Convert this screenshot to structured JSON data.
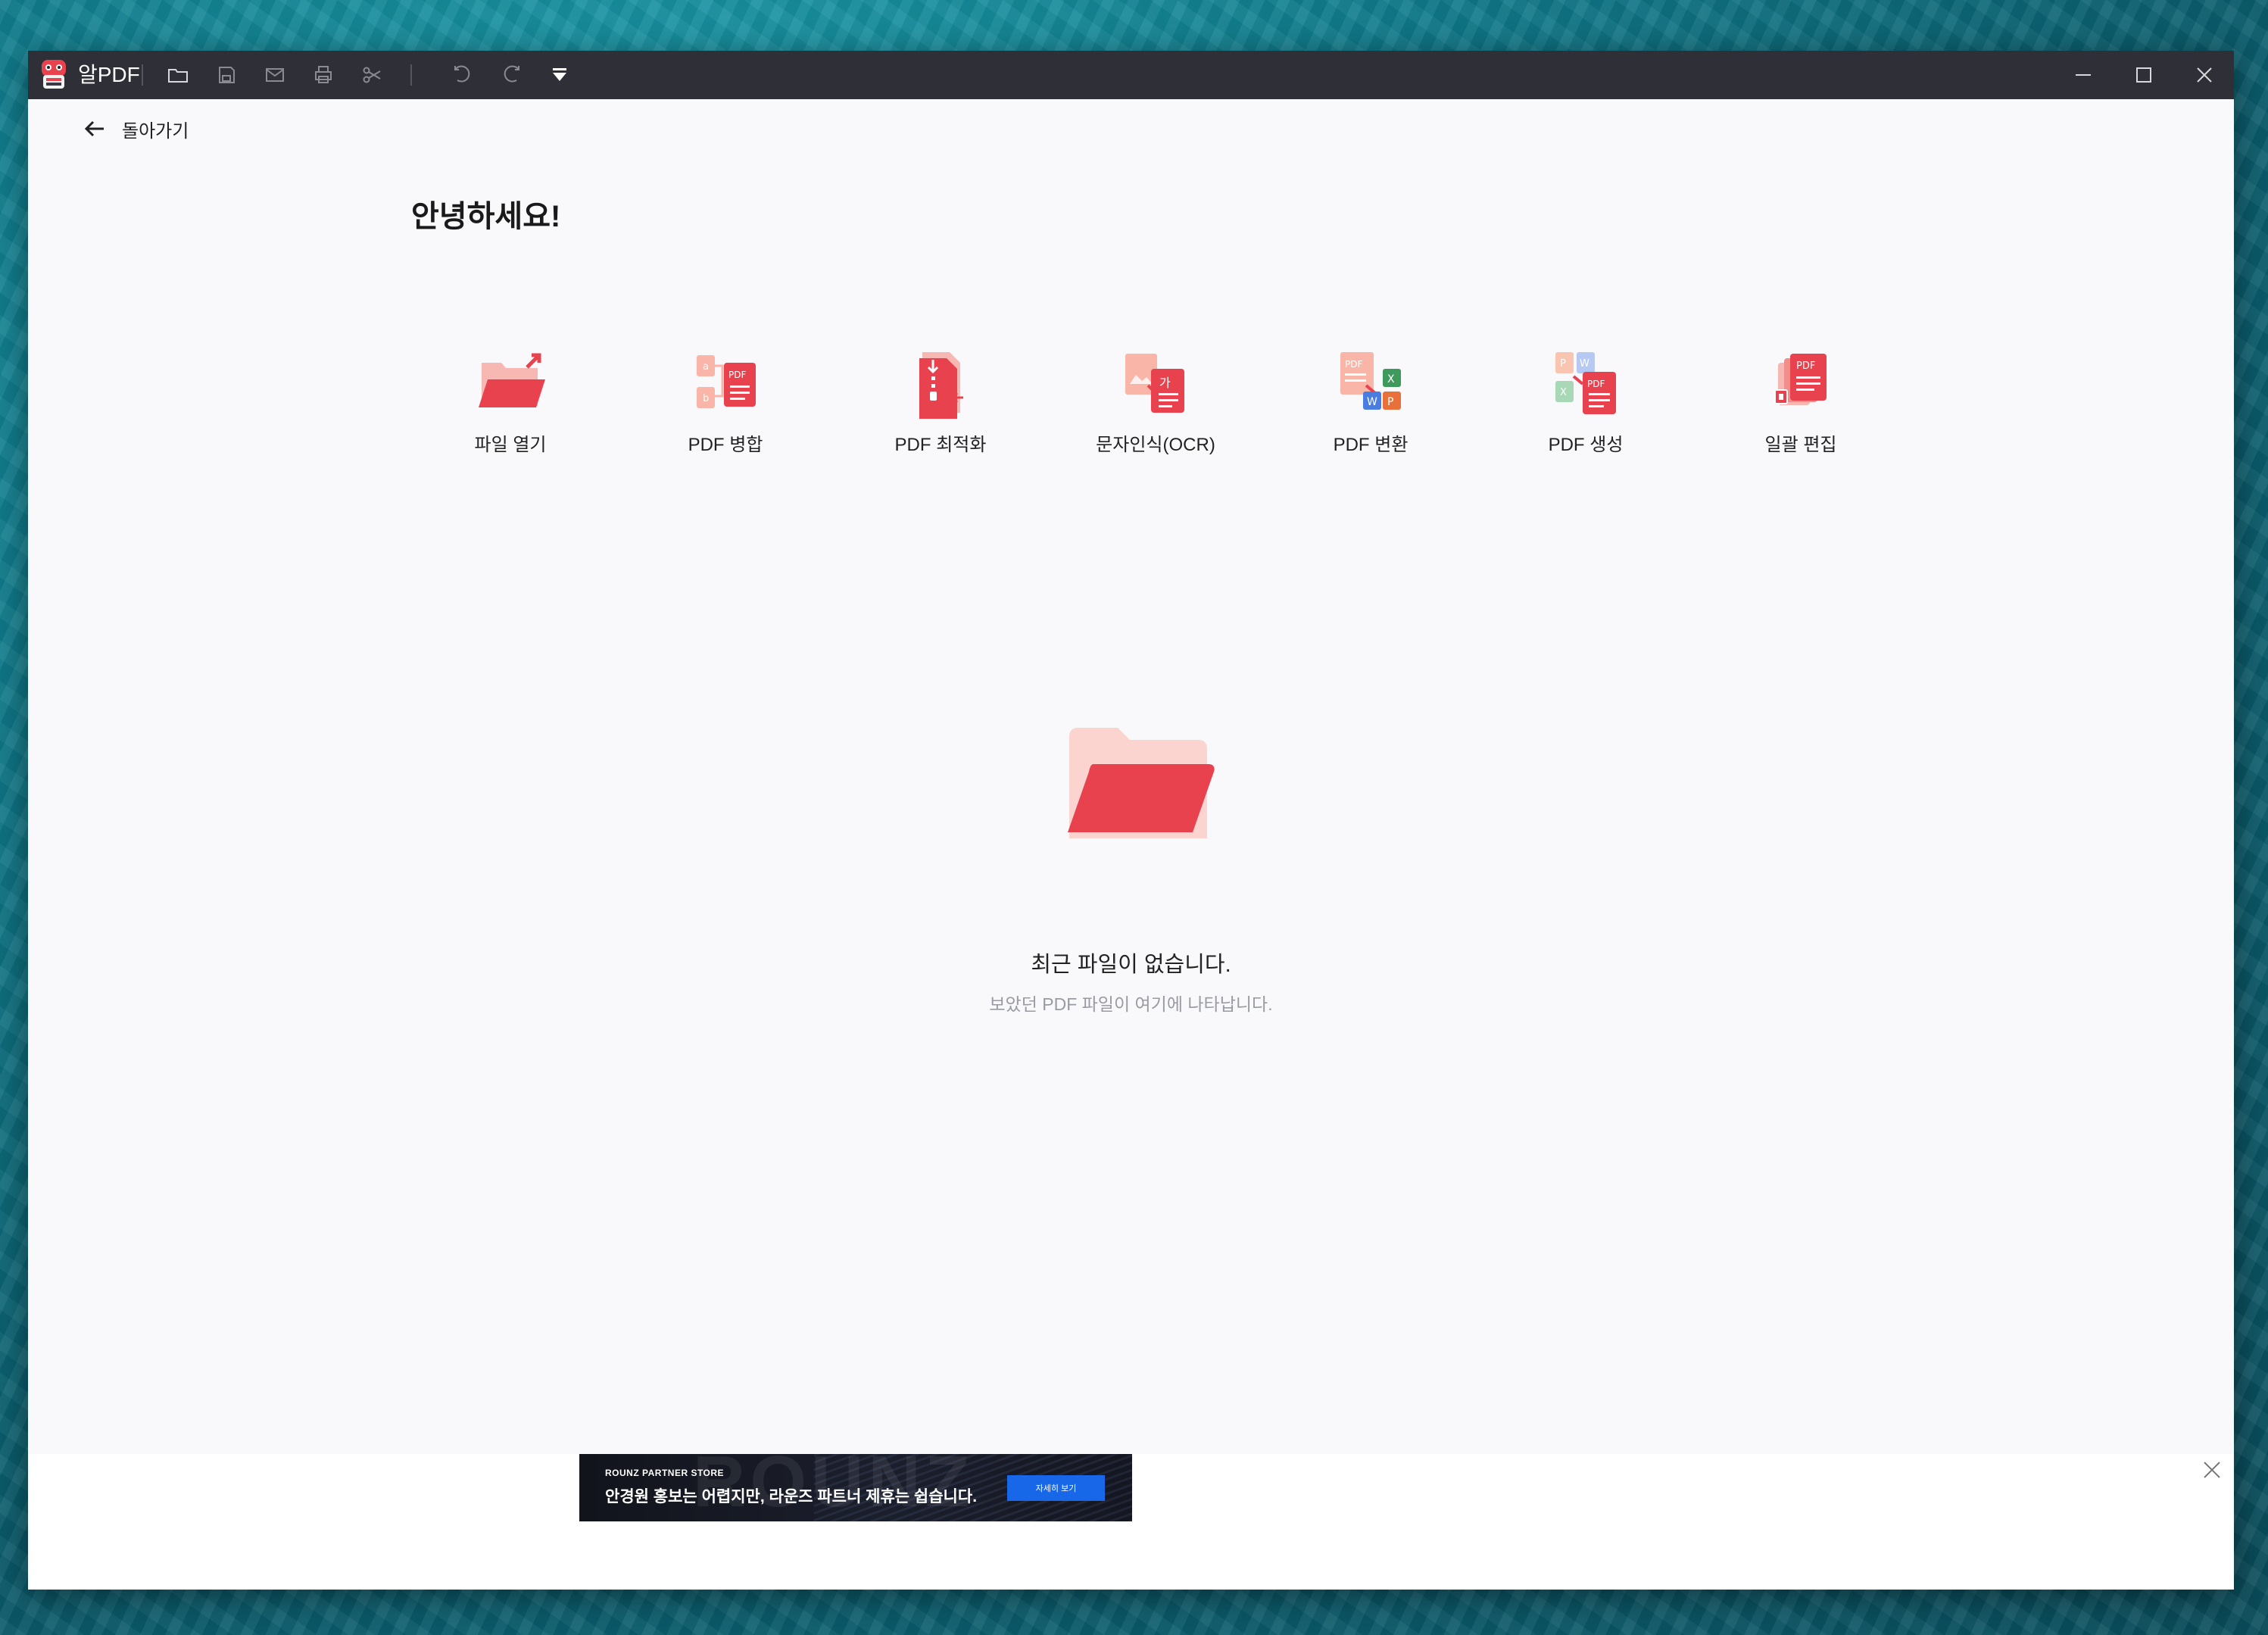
{
  "app": {
    "title": "알PDF"
  },
  "nav": {
    "back_label": "돌아가기"
  },
  "home": {
    "greeting": "안녕하세요!",
    "tools": [
      {
        "label": "파일 열기",
        "icon": "folder-open-icon"
      },
      {
        "label": "PDF 병합",
        "icon": "pdf-merge-icon"
      },
      {
        "label": "PDF 최적화",
        "icon": "pdf-optimize-icon"
      },
      {
        "label": "문자인식(OCR)",
        "icon": "ocr-icon"
      },
      {
        "label": "PDF 변환",
        "icon": "pdf-convert-icon"
      },
      {
        "label": "PDF 생성",
        "icon": "pdf-create-icon"
      },
      {
        "label": "일괄 편집",
        "icon": "batch-edit-icon"
      }
    ]
  },
  "recent": {
    "empty_title": "최근 파일이 없습니다.",
    "empty_subtitle": "보았던 PDF 파일이 여기에 나타납니다."
  },
  "ad": {
    "brand": "ROUNZ PARTNER STORE",
    "bg_word": "ROUNZ",
    "text": "안경원 홍보는 어렵지만, 라운즈 파트너 제휴는 쉽습니다.",
    "button": "자세히 보기"
  },
  "colors": {
    "accent_red": "#e8424e",
    "titlebar": "#2f2f37",
    "ad_button": "#1767e8"
  }
}
